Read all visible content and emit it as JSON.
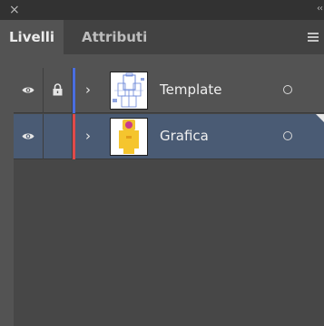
{
  "window": {
    "close_glyph": "×",
    "collapse_glyph": "‹‹"
  },
  "tabs": [
    {
      "label": "Livelli",
      "active": true
    },
    {
      "label": "Attributi",
      "active": false
    }
  ],
  "layers": [
    {
      "name": "Template",
      "visible": true,
      "locked": true,
      "color": "#4a6ee0",
      "selected": false
    },
    {
      "name": "Grafica",
      "visible": true,
      "locked": false,
      "color": "#e04a4a",
      "selected": true
    }
  ],
  "colors": {
    "panel_bg": "#535353",
    "selection": "#4a5b74"
  }
}
